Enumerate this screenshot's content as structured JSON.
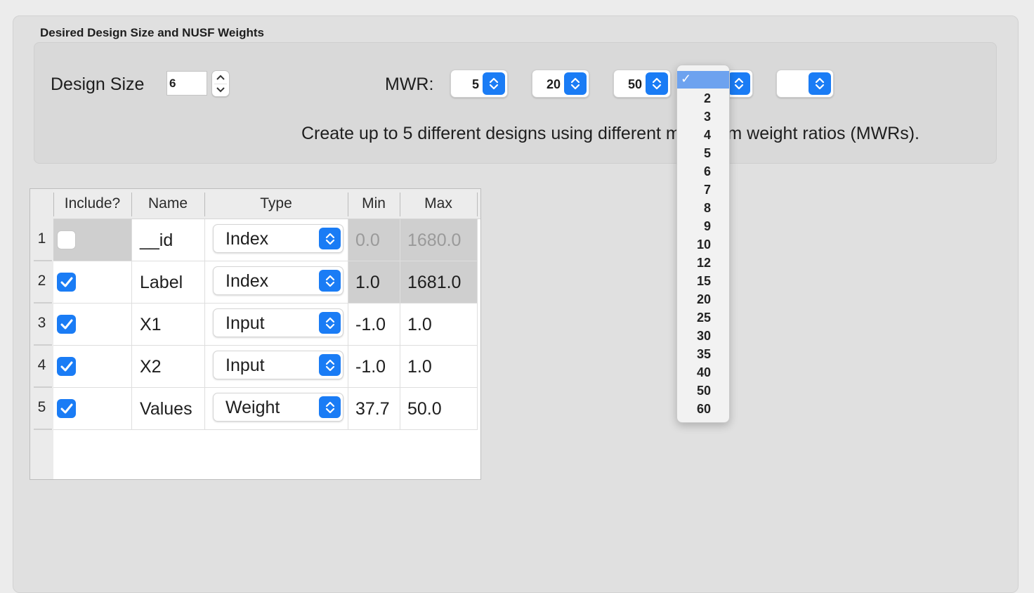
{
  "group": {
    "title": "Desired Design Size and NUSF Weights"
  },
  "design_size": {
    "label": "Design Size",
    "value": "6"
  },
  "mwr": {
    "label": "MWR:",
    "popups": [
      "5",
      "20",
      "50",
      "",
      ""
    ],
    "hint": "Create up to 5 different designs using different maximum weight ratios (MWRs)."
  },
  "table": {
    "headers": [
      "Include?",
      "Name",
      "Type",
      "Min",
      "Max"
    ],
    "rows": [
      {
        "num": "1",
        "include": false,
        "name": "__id",
        "type": "Index",
        "min": "0.0",
        "max": "1680.0"
      },
      {
        "num": "2",
        "include": true,
        "name": "Label",
        "type": "Index",
        "min": "1.0",
        "max": "1681.0"
      },
      {
        "num": "3",
        "include": true,
        "name": "X1",
        "type": "Input",
        "min": "-1.0",
        "max": "1.0"
      },
      {
        "num": "4",
        "include": true,
        "name": "X2",
        "type": "Input",
        "min": "-1.0",
        "max": "1.0"
      },
      {
        "num": "5",
        "include": true,
        "name": "Values",
        "type": "Weight",
        "min": "37.7",
        "max": "50.0"
      }
    ]
  },
  "dropdown": {
    "check": "✓",
    "items": [
      "2",
      "3",
      "4",
      "5",
      "6",
      "7",
      "8",
      "9",
      "10",
      "12",
      "15",
      "20",
      "25",
      "30",
      "35",
      "40",
      "50",
      "60"
    ]
  },
  "colors": {
    "accent": "#1a7cf5",
    "menu_highlight": "#6da2ef"
  }
}
